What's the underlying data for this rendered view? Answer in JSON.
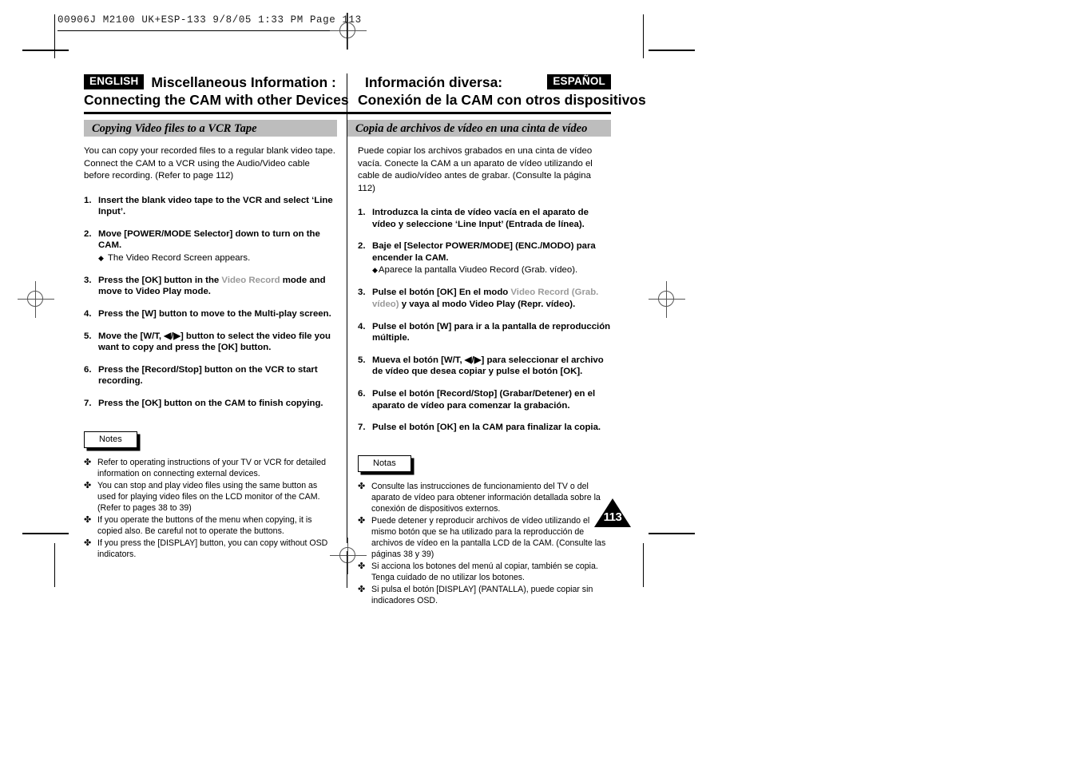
{
  "prepress": {
    "header_text": "00906J M2100 UK+ESP-133   9/8/05 1:33 PM   Page 113"
  },
  "header": {
    "left": {
      "badge": "ENGLISH",
      "title_line1": "Miscellaneous Information :",
      "title_line2": "Connecting the CAM with other Devices",
      "subhead": "Copying Video files to a VCR Tape"
    },
    "right": {
      "badge": "ESPAÑOL",
      "title_line1": "Información diversa:",
      "title_line2": "Conexión de la CAM con otros dispositivos",
      "subhead": "Copia de archivos de vídeo en una cinta de vídeo"
    }
  },
  "english": {
    "intro": "You can copy your recorded files to a regular blank video tape. Connect the CAM to a VCR using the Audio/Video cable before recording. (Refer to page 112)",
    "steps": [
      {
        "num": "1.",
        "text": "Insert the blank video tape to the VCR and select ‘Line Input’."
      },
      {
        "num": "2.",
        "text": "Move [POWER/MODE Selector] down to turn on the CAM.",
        "sub": "The Video Record Screen appears."
      },
      {
        "num": "3.",
        "text_pre": "Press the [OK] button in the ",
        "text_muted": "Video Record",
        "text_post": " mode and move to Video Play mode."
      },
      {
        "num": "4.",
        "text": "Press the [W] button to move to the Multi-play screen."
      },
      {
        "num": "5.",
        "text": "Move the [W/T, ◀/▶] button to select the video file you want to copy and press the [OK] button."
      },
      {
        "num": "6.",
        "text": "Press the [Record/Stop] button on the VCR to start recording."
      },
      {
        "num": "7.",
        "text": "Press the [OK] button on the CAM to finish copying."
      }
    ],
    "notes_label": "Notes",
    "notes": [
      "Refer to operating instructions of your TV or VCR for detailed information on connecting external devices.",
      "You can stop and play video files using the same button as used for playing video files on the LCD monitor of the CAM. (Refer to pages 38 to 39)",
      "If you operate the buttons of the menu when copying, it is copied also. Be careful not to operate the buttons.",
      "If you press the [DISPLAY] button, you can copy without OSD indicators."
    ]
  },
  "spanish": {
    "intro": "Puede copiar los archivos grabados en una cinta de vídeo vacía. Conecte la CAM a un aparato de vídeo utilizando el cable de audio/vídeo antes de grabar. (Consulte la página 112)",
    "steps": [
      {
        "num": "1.",
        "text": "Introduzca la cinta de vídeo vacía en el aparato de vídeo y seleccione ‘Line Input’ (Entrada de línea)."
      },
      {
        "num": "2.",
        "text": "Baje el [Selector POWER/MODE] (ENC./MODO) para encender la CAM.",
        "sub": "Aparece la pantalla Viudeo Record (Grab. vídeo)."
      },
      {
        "num": "3.",
        "text_pre": "Pulse el botón [OK] En el modo ",
        "text_muted": "Video Record (Grab. vídeo)",
        "text_post": " y vaya al modo Video Play (Repr. vídeo)."
      },
      {
        "num": "4.",
        "text": "Pulse el botón [W] para ir a la pantalla de reproducción múltiple."
      },
      {
        "num": "5.",
        "text": "Mueva el botón [W/T, ◀/▶] para seleccionar el archivo de vídeo que desea copiar y pulse el botón [OK]."
      },
      {
        "num": "6.",
        "text": "Pulse el botón [Record/Stop] (Grabar/Detener) en el aparato de vídeo para comenzar la grabación."
      },
      {
        "num": "7.",
        "text": "Pulse el botón [OK] en la CAM para finalizar la copia."
      }
    ],
    "notes_label": "Notas",
    "notes": [
      "Consulte las instrucciones de funcionamiento del TV o del aparato de vídeo para obtener información detallada sobre la conexión de dispositivos externos.",
      "Puede detener y reproducir archivos de vídeo utilizando el mismo botón que se ha utilizado para la reproducción de archivos de vídeo en la pantalla LCD de la CAM. (Consulte las páginas 38 y 39)",
      "Si acciona los botones del menú al copiar, también se copia. Tenga cuidado de no utilizar los botones.",
      "Si pulsa el botón [DISPLAY] (PANTALLA), puede copiar sin indicadores OSD."
    ]
  },
  "page_number": "113",
  "glyphs": {
    "diamond": "◆",
    "note_mark": "✤"
  }
}
